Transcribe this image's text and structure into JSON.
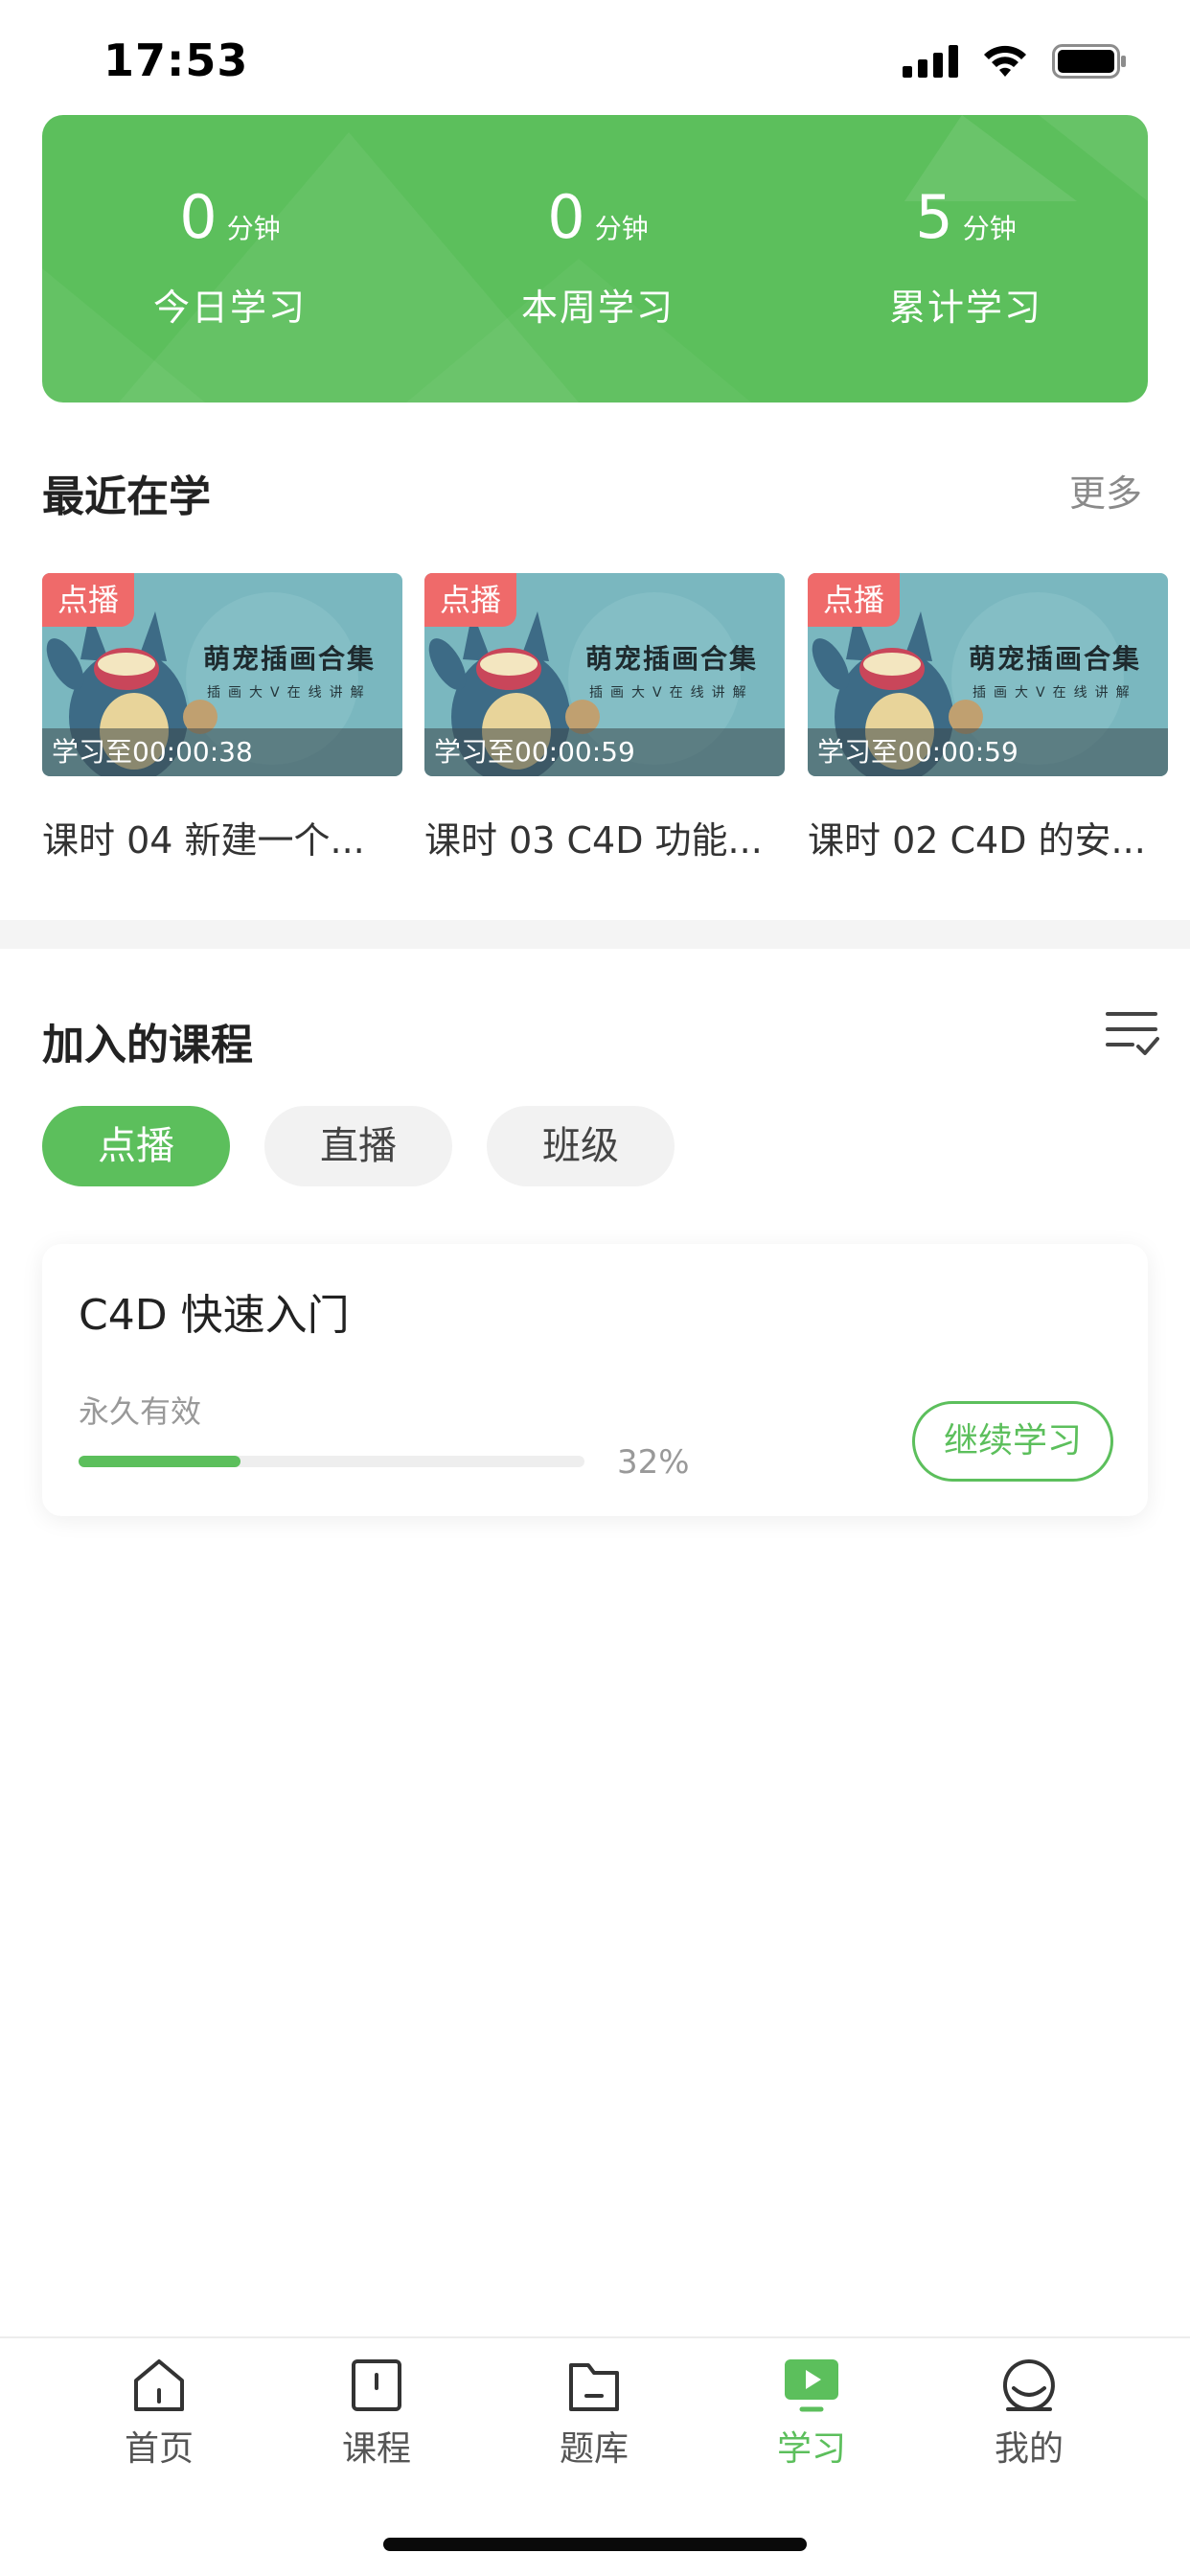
{
  "status_bar": {
    "time": "17:53"
  },
  "stats": [
    {
      "value": "0",
      "unit": "分钟",
      "label": "今日学习"
    },
    {
      "value": "0",
      "unit": "分钟",
      "label": "本周学习"
    },
    {
      "value": "5",
      "unit": "分钟",
      "label": "累计学习"
    }
  ],
  "recent": {
    "title": "最近在学",
    "more": "更多",
    "items": [
      {
        "badge": "点播",
        "thumb_title": "萌宠插画合集",
        "thumb_sub": "插画大V在线讲解",
        "progress": "学习至00:00:38",
        "label": "课时 04 新建一个..."
      },
      {
        "badge": "点播",
        "thumb_title": "萌宠插画合集",
        "thumb_sub": "插画大V在线讲解",
        "progress": "学习至00:00:59",
        "label": "课时 03 C4D 功能..."
      },
      {
        "badge": "点播",
        "thumb_title": "萌宠插画合集",
        "thumb_sub": "插画大V在线讲解",
        "progress": "学习至00:00:59",
        "label": "课时 02 C4D 的安..."
      }
    ]
  },
  "joined": {
    "title": "加入的课程",
    "chips": [
      {
        "label": "点播",
        "active": true
      },
      {
        "label": "直播",
        "active": false
      },
      {
        "label": "班级",
        "active": false
      }
    ],
    "course": {
      "title": "C4D 快速入门",
      "validity": "永久有效",
      "progress": 0.32,
      "progress_text": "32%",
      "button": "继续学习"
    }
  },
  "tab_bar": {
    "items": [
      {
        "label": "首页",
        "icon": "home-icon"
      },
      {
        "label": "课程",
        "icon": "course-icon"
      },
      {
        "label": "题库",
        "icon": "folder-icon"
      },
      {
        "label": "学习",
        "icon": "play-icon",
        "active": true
      },
      {
        "label": "我的",
        "icon": "profile-icon"
      }
    ]
  },
  "colors": {
    "accent": "#5cbf5c",
    "badge": "#ef6a6a"
  }
}
